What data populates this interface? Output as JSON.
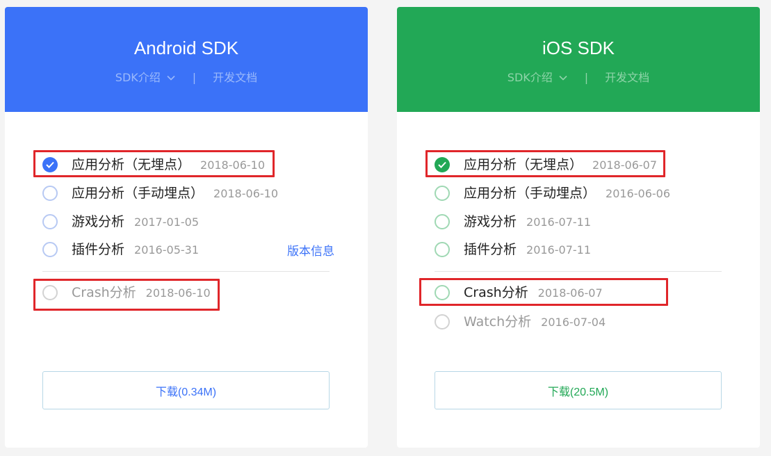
{
  "android": {
    "title": "Android SDK",
    "nav_intro": "SDK介绍",
    "nav_sep": "|",
    "nav_doc": "开发文档",
    "items": [
      {
        "label": "应用分析（无埋点）",
        "date": "2018-06-10",
        "checked": true
      },
      {
        "label": "应用分析（手动埋点）",
        "date": "2018-06-10",
        "checked": false
      },
      {
        "label": "游戏分析",
        "date": "2017-01-05",
        "checked": false
      },
      {
        "label": "插件分析",
        "date": "2016-05-31",
        "checked": false
      }
    ],
    "version_link": "版本信息",
    "crash": {
      "label": "Crash分析",
      "date": "2018-06-10",
      "checked": false
    },
    "download": "下载(0.34M)"
  },
  "ios": {
    "title": "iOS SDK",
    "nav_intro": "SDK介绍",
    "nav_sep": "|",
    "nav_doc": "开发文档",
    "items": [
      {
        "label": "应用分析（无埋点）",
        "date": "2018-06-07",
        "checked": true
      },
      {
        "label": "应用分析（手动埋点）",
        "date": "2016-06-06",
        "checked": false
      },
      {
        "label": "游戏分析",
        "date": "2016-07-11",
        "checked": false
      },
      {
        "label": "插件分析",
        "date": "2016-07-11",
        "checked": false
      }
    ],
    "crash": {
      "label": "Crash分析",
      "date": "2018-06-07",
      "checked": false
    },
    "watch": {
      "label": "Watch分析",
      "date": "2016-07-04",
      "checked": false
    },
    "download": "下载(20.5M)"
  },
  "colors": {
    "android_accent": "#3b72f8",
    "ios_accent": "#22a856",
    "highlight": "#e0262a"
  }
}
